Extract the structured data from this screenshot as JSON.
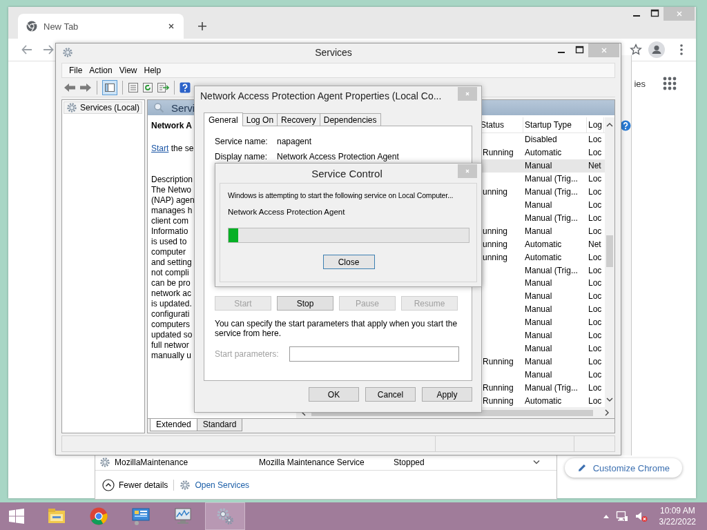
{
  "browser": {
    "tabs": [
      {
        "title": "New Tab",
        "selected": true
      }
    ],
    "partial_link": "ies",
    "customize_button": "Customize Chrome"
  },
  "task_manager": {
    "row": {
      "name": "MozillaMaintenance",
      "description": "Mozilla Maintenance Service",
      "status": "Stopped"
    },
    "fewer_details": "Fewer details",
    "open_services": "Open Services"
  },
  "services_window": {
    "title": "Services",
    "menu": [
      "File",
      "Action",
      "View",
      "Help"
    ],
    "tree": [
      {
        "label": "Services (Local)",
        "selected": true
      }
    ],
    "header": "Servi",
    "service_name": "Network A",
    "start_link": "Start",
    "start_text": " the se",
    "description_label": "Description",
    "description_lines": [
      "The Netwo",
      "(NAP) agen",
      "manages h",
      "client com",
      "Informatio",
      "is used to",
      "computer",
      "and setting",
      "not compli",
      "can be pro",
      "network ac",
      "is updated.",
      "configurati",
      "computers",
      "updated so",
      "full networ",
      "manually u"
    ],
    "columns": [
      "Status",
      "Startup Type",
      "Log"
    ],
    "rows": [
      {
        "startup": "Disabled",
        "log": "Loc",
        "selected": false
      },
      {
        "status": "Running",
        "startup": "Automatic",
        "log": "Loc",
        "selected": false
      },
      {
        "startup": "Manual",
        "log": "Net",
        "selected": true
      },
      {
        "startup": "Manual (Trig...",
        "log": "Loc",
        "selected": false
      },
      {
        "status": "unning",
        "startup": "Manual (Trig...",
        "log": "Loc",
        "selected": false
      },
      {
        "startup": "Manual",
        "log": "Loc",
        "selected": false
      },
      {
        "startup": "Manual (Trig...",
        "log": "Loc",
        "selected": false
      },
      {
        "status": "unning",
        "startup": "Manual",
        "log": "Loc",
        "selected": false
      },
      {
        "status": "unning",
        "startup": "Automatic",
        "log": "Net",
        "selected": false
      },
      {
        "status": "unning",
        "startup": "Automatic",
        "log": "Loc",
        "selected": false
      },
      {
        "startup": "Manual (Trig...",
        "log": "Loc",
        "selected": false
      },
      {
        "startup": "Manual",
        "log": "Loc",
        "selected": false
      },
      {
        "startup": "Manual",
        "log": "Loc",
        "selected": false
      },
      {
        "startup": "Manual",
        "log": "Loc",
        "selected": false
      },
      {
        "startup": "Manual",
        "log": "Loc",
        "selected": false
      },
      {
        "startup": "Manual",
        "log": "Loc",
        "selected": false
      },
      {
        "startup": "Manual",
        "log": "Loc",
        "selected": false
      },
      {
        "status": "Running",
        "startup": "Manual",
        "log": "Loc",
        "selected": false
      },
      {
        "startup": "Manual",
        "log": "Loc",
        "selected": false
      },
      {
        "status": "Running",
        "startup": "Manual (Trig...",
        "log": "Loc",
        "selected": false
      },
      {
        "status": "Running",
        "startup": "Automatic",
        "log": "Loc",
        "selected": false
      }
    ],
    "view_tabs": [
      {
        "label": "Extended",
        "selected": true
      },
      {
        "label": "Standard",
        "selected": false
      }
    ]
  },
  "properties_dialog": {
    "title": "Network Access Protection Agent Properties (Local Co...",
    "tabs": [
      {
        "label": "General",
        "selected": true
      },
      {
        "label": "Log On",
        "selected": false
      },
      {
        "label": "Recovery",
        "selected": false
      },
      {
        "label": "Dependencies",
        "selected": false
      }
    ],
    "fields": [
      {
        "label": "Service name:",
        "value": "napagent"
      },
      {
        "label": "Display name:",
        "value": "Network Access Protection Agent"
      }
    ],
    "control_buttons": [
      {
        "label": "Start",
        "disabled": true
      },
      {
        "label": "Stop",
        "disabled": false
      },
      {
        "label": "Pause",
        "disabled": true
      },
      {
        "label": "Resume",
        "disabled": true
      }
    ],
    "hint": "You can specify the start parameters that apply when you start the service from here.",
    "start_parameters": {
      "label": "Start parameters:",
      "disabled": true
    },
    "buttons": [
      "OK",
      "Cancel",
      "Apply"
    ]
  },
  "service_control": {
    "title": "Service Control",
    "message": "Windows is attempting to start the following service on Local Computer...",
    "service": "Network Access Protection Agent",
    "progress": {
      "level": 0.04
    },
    "button": "Close"
  },
  "taskbar": {
    "apps": [
      {
        "kind": "explorer",
        "selected": false
      },
      {
        "kind": "chrome",
        "selected": false
      },
      {
        "kind": "control",
        "selected": false
      },
      {
        "kind": "monitor",
        "selected": false
      },
      {
        "kind": "services",
        "selected": true
      }
    ],
    "volume": {
      "muted": true
    },
    "clock": {
      "time": "10:09 AM",
      "date": "3/22/2022"
    }
  }
}
